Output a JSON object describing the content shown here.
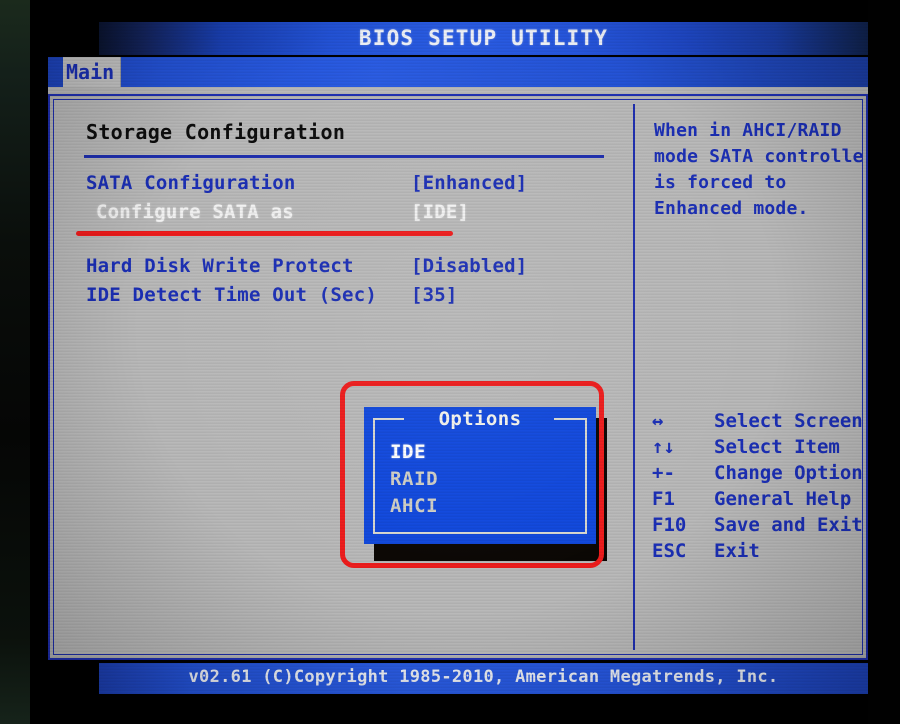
{
  "window": {
    "title": "BIOS SETUP UTILITY",
    "footer": "v02.61 (C)Copyright 1985-2010, American Megatrends, Inc."
  },
  "menu": {
    "tabs": [
      {
        "label": "Main",
        "active": true
      }
    ]
  },
  "main": {
    "section_title": "Storage Configuration",
    "settings": [
      {
        "label": "SATA Configuration",
        "value": "[Enhanced]",
        "state": "normal",
        "indent": false
      },
      {
        "label": "Configure SATA as",
        "value": "[IDE]",
        "state": "selected",
        "indent": true
      },
      {
        "label": "Hard Disk Write Protect",
        "value": "[Disabled]",
        "state": "normal",
        "indent": false
      },
      {
        "label": "IDE Detect Time Out (Sec)",
        "value": "[35]",
        "state": "normal",
        "indent": false
      }
    ]
  },
  "options_dialog": {
    "title": "Options",
    "items": [
      {
        "label": "IDE",
        "selected": true
      },
      {
        "label": "RAID",
        "selected": false
      },
      {
        "label": "AHCI",
        "selected": false
      }
    ]
  },
  "help": {
    "text": "When in AHCI/RAID mode SATA controller is forced to Enhanced mode."
  },
  "key_legend": [
    {
      "key": "↔",
      "desc": "Select Screen"
    },
    {
      "key": "↑↓",
      "desc": "Select Item"
    },
    {
      "key": "+-",
      "desc": "Change Option"
    },
    {
      "key": "F1",
      "desc": "General Help"
    },
    {
      "key": "F10",
      "desc": "Save and Exit"
    },
    {
      "key": "ESC",
      "desc": "Exit"
    }
  ],
  "annotations": [
    {
      "name": "underline-configure-sata-as",
      "shape": "line",
      "color": "#ef1b1b"
    },
    {
      "name": "highlight-options-dialog",
      "shape": "rectangle",
      "color": "#ef1b1b"
    }
  ],
  "colors": {
    "screen_blue": "#2a5ce3",
    "panel_gray": "#b9b9b9",
    "text_blue": "#1b2fb6",
    "text_white": "#f2f2f2",
    "dialog_blue": "#1048dd",
    "annotation_red": "#ef1b1b"
  }
}
